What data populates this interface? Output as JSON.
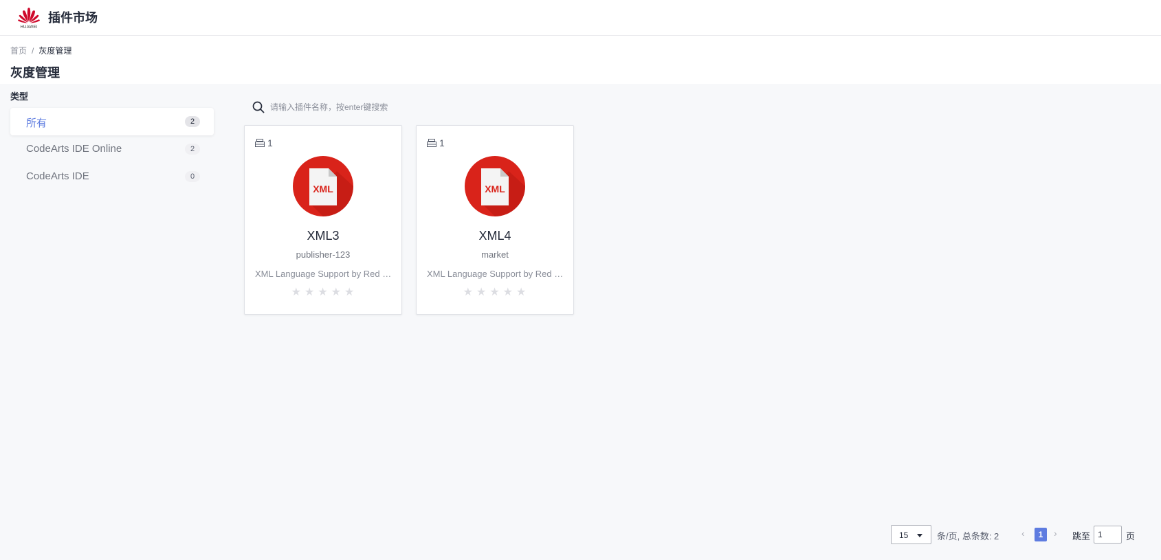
{
  "header": {
    "brand": "HUAWEI",
    "app_title": "插件市场"
  },
  "breadcrumb": {
    "home": "首页",
    "separator": "/",
    "current": "灰度管理"
  },
  "page_title": "灰度管理",
  "sidebar": {
    "section_label": "类型",
    "items": [
      {
        "label": "所有",
        "count": "2",
        "active": true
      },
      {
        "label": "CodeArts IDE Online",
        "count": "2",
        "active": false
      },
      {
        "label": "CodeArts IDE",
        "count": "0",
        "active": false
      }
    ]
  },
  "search": {
    "placeholder": "请输入插件名称，按enter键搜索",
    "icon": "search-icon"
  },
  "cards": [
    {
      "version_count": "1",
      "icon_text": "XML",
      "name": "XML3",
      "publisher": "publisher-123",
      "description": "XML Language Support by Red Hat",
      "stars": "★★★★★",
      "rating": 0
    },
    {
      "version_count": "1",
      "icon_text": "XML",
      "name": "XML4",
      "publisher": "market",
      "description": "XML Language Support by Red Hat",
      "stars": "★★★★★",
      "rating": 0
    }
  ],
  "pagination": {
    "page_size": "15",
    "per_page_text": "条/页,  总条数: 2",
    "prev": "‹",
    "current_page": "1",
    "next": "›",
    "goto_label": "跳至",
    "goto_value": "1",
    "goto_suffix": "页"
  },
  "colors": {
    "accent": "#5e7ce0",
    "brand_red": "#cf0a2c",
    "icon_red": "#d9231a"
  }
}
